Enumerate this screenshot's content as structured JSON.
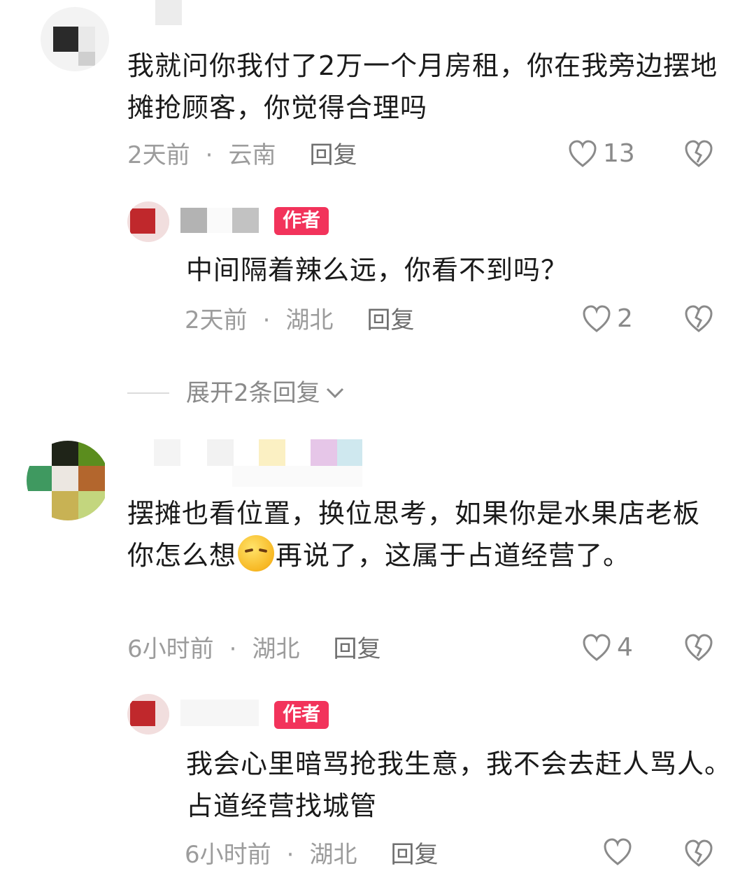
{
  "comments": [
    {
      "text": "我就问你我付了2万一个月房租，你在我旁边摆地摊抢顾客，你觉得合理吗",
      "time": "2天前",
      "location": "云南",
      "reply_label": "回复",
      "likes": "13"
    },
    {
      "badge": "作者",
      "text": "中间隔着辣么远，你看不到吗？",
      "time": "2天前",
      "location": "湖北",
      "reply_label": "回复",
      "likes": "2"
    },
    {
      "text_part1": "摆摊也看位置，换位思考，如果你是水果店老板你怎么想",
      "emoji": "thinking-face-emoji",
      "text_part2": "再说了，这属于占道经营了。",
      "time": "6小时前",
      "location": "湖北",
      "reply_label": "回复",
      "likes": "4"
    },
    {
      "badge": "作者",
      "text": "我会心里暗骂抢我生意，我不会去赶人骂人。占道经营找城管",
      "time": "6小时前",
      "location": "湖北",
      "reply_label": "回复",
      "likes": ""
    }
  ],
  "expand_replies": "展开2条回复",
  "separator": "·",
  "colors": {
    "badge": "#f2335b",
    "meta": "#9c9c9c",
    "reply": "#6e6e6e",
    "text": "#1a1a1a"
  }
}
